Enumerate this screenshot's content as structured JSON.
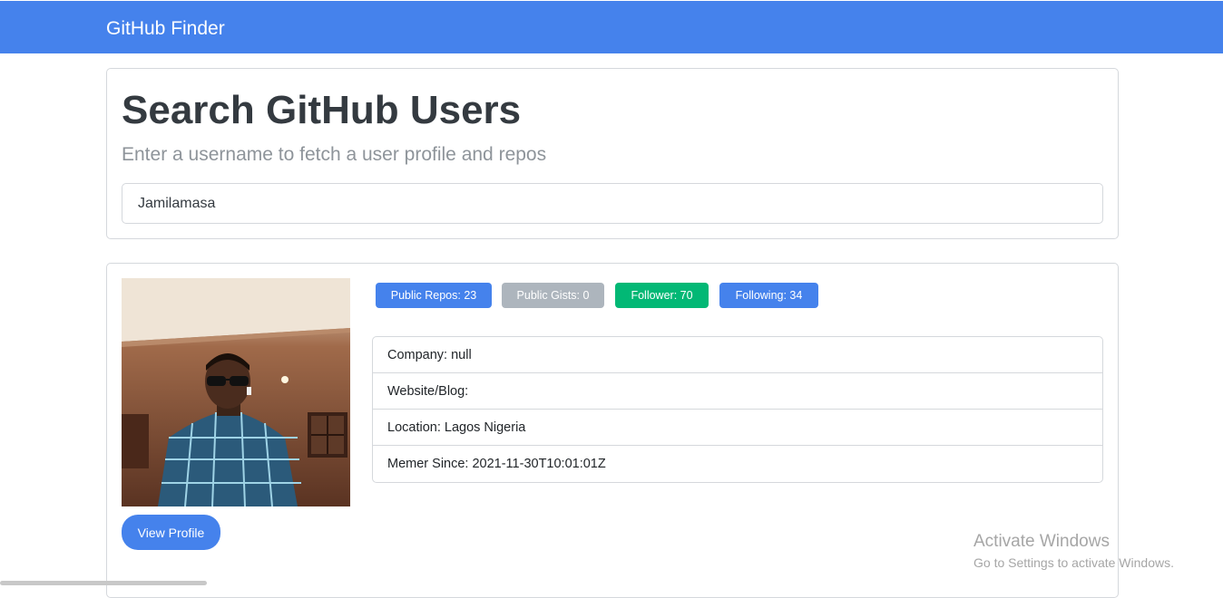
{
  "navbar": {
    "brand": "GitHub Finder"
  },
  "search": {
    "title": "Search GitHub Users",
    "subtitle": "Enter a username to fetch a user profile and repos",
    "value": "Jamilamasa"
  },
  "profile": {
    "view_profile_label": "View Profile",
    "badges": {
      "repos": "Public Repos: 23",
      "gists": "Public Gists: 0",
      "follower": "Follower: 70",
      "following": "Following: 34"
    },
    "info": [
      "Company: null",
      "Website/Blog:",
      "Location: Lagos Nigeria",
      "Memer Since: 2021-11-30T10:01:01Z"
    ]
  },
  "watermark": {
    "title": "Activate Windows",
    "subtitle": "Go to Settings to activate Windows."
  },
  "colors": {
    "primary": "#4582ec",
    "secondary": "#adb5bd",
    "success": "#02b875"
  }
}
